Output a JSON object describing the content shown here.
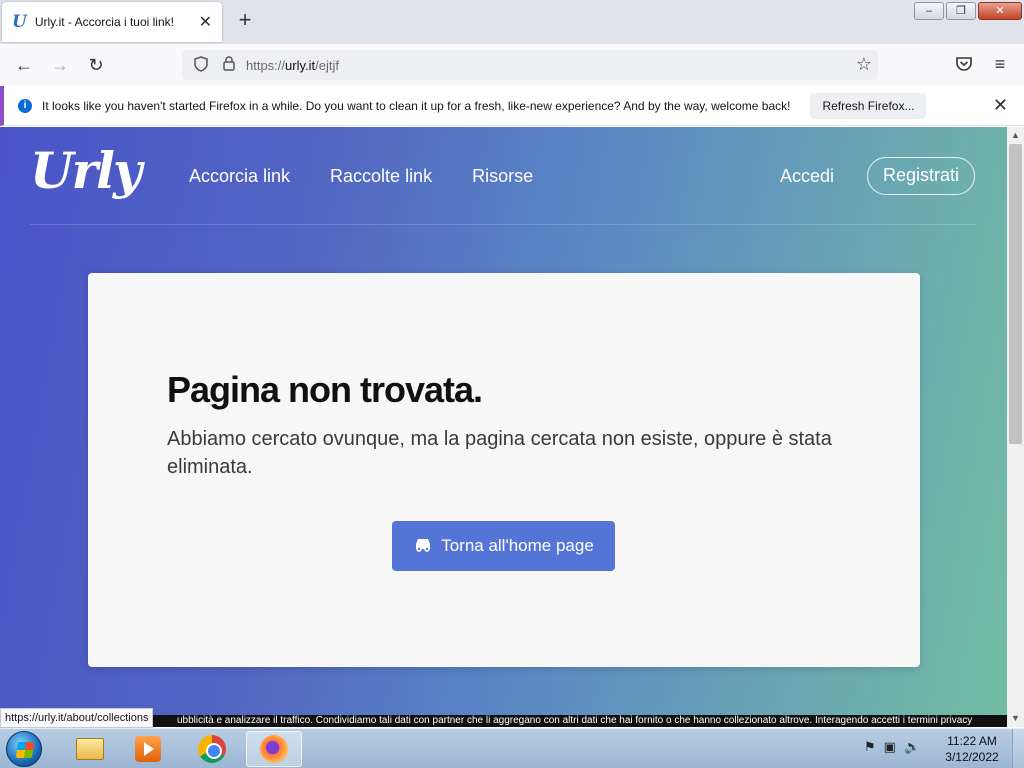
{
  "browser": {
    "tab": {
      "favicon": "U",
      "title": "Urly.it - Accorcia i tuoi link!",
      "close": "✕"
    },
    "new_tab": "+",
    "window_controls": {
      "minimize": "–",
      "restore": "❐",
      "close": "✕"
    },
    "nav": {
      "back": "←",
      "forward": "→",
      "reload": "↻"
    },
    "url": {
      "prefix": "https://",
      "host": "urly.it",
      "path": "/ejtjf"
    },
    "icons": {
      "shield": "shield-icon",
      "lock": "lock-icon",
      "star": "☆",
      "pocket": "pocket-icon",
      "menu": "≡"
    },
    "notification": {
      "icon": "i",
      "text": "It looks like you haven't started Firefox in a while. Do you want to clean it up for a fresh, like-new experience? And by the way, welcome back!",
      "button": "Refresh Firefox...",
      "close": "✕"
    },
    "status_link": "https://urly.it/about/collections"
  },
  "site": {
    "logo": "Urly",
    "nav": [
      {
        "label": "Accorcia link"
      },
      {
        "label": "Raccolte link"
      },
      {
        "label": "Risorse"
      }
    ],
    "login": "Accedi",
    "register": "Registrati"
  },
  "error": {
    "title": "Pagina non trovata.",
    "message": "Abbiamo cercato ovunque, ma la pagina cercata non esiste, oppure è stata eliminata.",
    "button": "Torna all'home page"
  },
  "cookie_banner": "ubblicità e analizzare il traffico. Condividiamo tali dati con partner che li aggregano con altri dati che hai fornito o che hanno collezionato altrove. Interagendo accetti i termini privacy",
  "taskbar": {
    "apps": [
      "windows-explorer-icon",
      "media-player-icon",
      "chrome-icon",
      "firefox-icon"
    ],
    "clock_time": "11:22 AM",
    "clock_date": "3/12/2022"
  },
  "colors": {
    "gradient_start": "#4a54c8",
    "gradient_end": "#72bca2",
    "button": "#5475d6",
    "notification_accent": "#8f4ec9"
  }
}
